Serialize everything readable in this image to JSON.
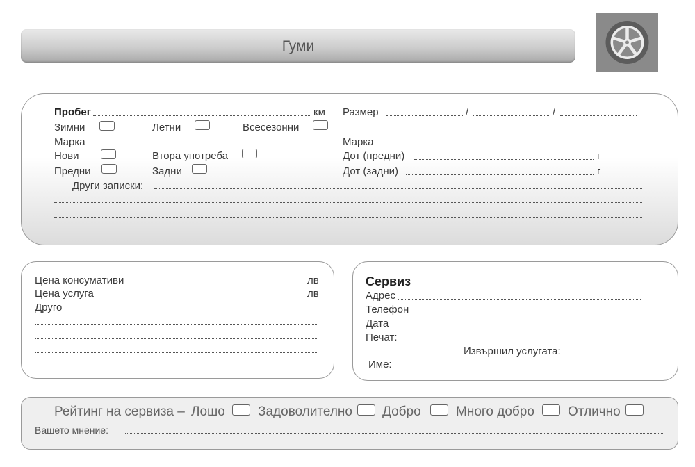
{
  "header": {
    "title": "Гуми",
    "icon": "wheel-icon"
  },
  "main": {
    "mileage_label": "Пробег",
    "mileage_unit": "км",
    "winter_label": "Зимни",
    "summer_label": "Летни",
    "allseason_label": "Всесезонни",
    "brand_left_label": "Марка",
    "new_label": "Нови",
    "used_label": "Втора употреба",
    "front_label": "Предни",
    "rear_label": "Задни",
    "size_label": "Размер",
    "size_sep_1": "/",
    "size_sep_2": "/",
    "brand_right_label": "Марка",
    "dot_front_label": "Дот (предни)",
    "dot_rear_label": "Дот (задни)",
    "year_unit_1": "г",
    "year_unit_2": "г",
    "notes_label": "Други записки:"
  },
  "cost": {
    "consumables_label": "Цена консумативи",
    "service_price_label": "Цена услуга",
    "currency_1": "лв",
    "currency_2": "лв",
    "other_label": "Друго"
  },
  "service": {
    "title": "Сервиз",
    "address_label": "Адрес",
    "phone_label": "Телефон",
    "date_label": "Дата",
    "stamp_label": "Печат:",
    "performed_by_label": "Извършил услугата:",
    "name_label": "Име:"
  },
  "rating": {
    "title": "Рейтинг на сервиза –",
    "options": [
      "Лошо",
      "Задоволително",
      "Добро",
      "Много добро",
      "Отлично"
    ],
    "opinion_label": "Вашето мнение:"
  },
  "colors": {
    "header_gradient_dark": "#a9a9a9",
    "icon_bg": "#8a8a8a",
    "border": "#9a9a9a"
  }
}
